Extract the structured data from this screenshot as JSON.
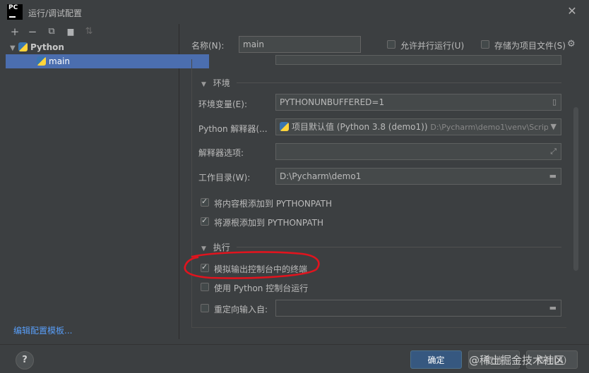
{
  "window": {
    "title": "运行/调试配置",
    "app_logo_text": "PC"
  },
  "toolbar": {
    "add": "+",
    "remove": "−",
    "copy": "⧉",
    "folder": "▆",
    "sort": "⇅"
  },
  "tree": [
    {
      "label": "Python",
      "expanded": true
    },
    {
      "label": "main",
      "selected": true
    }
  ],
  "left_footer": {
    "edit_templates": "编辑配置模板..."
  },
  "header": {
    "name_label": "名称(N):",
    "name_value": "main",
    "allow_parallel_label": "允许并行运行(U)",
    "store_as_project_label": "存储为项目文件(S)"
  },
  "env_section": {
    "title": "环境",
    "env_vars_label": "环境变量(E):",
    "env_vars_value": "PYTHONUNBUFFERED=1",
    "interpreter_label": "Python 解释器(...",
    "interpreter_value": "项目默认值 (Python 3.8 (demo1))",
    "interpreter_path": "D:\\Pycharm\\demo1\\venv\\Script",
    "interp_options_label": "解释器选项:",
    "interp_options_value": "",
    "workdir_label": "工作目录(W):",
    "workdir_value": "D:\\Pycharm\\demo1",
    "add_content_roots_label": "将内容根添加到 PYTHONPATH",
    "add_source_roots_label": "将源根添加到 PYTHONPATH"
  },
  "exec_section": {
    "title": "执行",
    "emulate_terminal_label": "模拟输出控制台中的终端",
    "use_python_console_label": "使用 Python 控制台运行",
    "redirect_input_label": "重定向输入自:",
    "redirect_input_value": ""
  },
  "checks": {
    "allow_parallel": false,
    "store_as_project": false,
    "add_content_roots": true,
    "add_source_roots": true,
    "emulate_terminal": true,
    "use_python_console": false,
    "redirect_input": false
  },
  "buttons": {
    "help": "?",
    "ok": "确定",
    "cancel": "取消",
    "apply": "应用(A)"
  },
  "watermark": "@稀土掘金技术社区",
  "colors": {
    "accent": "#4b6eaf",
    "ok_button": "#365880",
    "link": "#589df6",
    "annotation": "#e0141e"
  }
}
